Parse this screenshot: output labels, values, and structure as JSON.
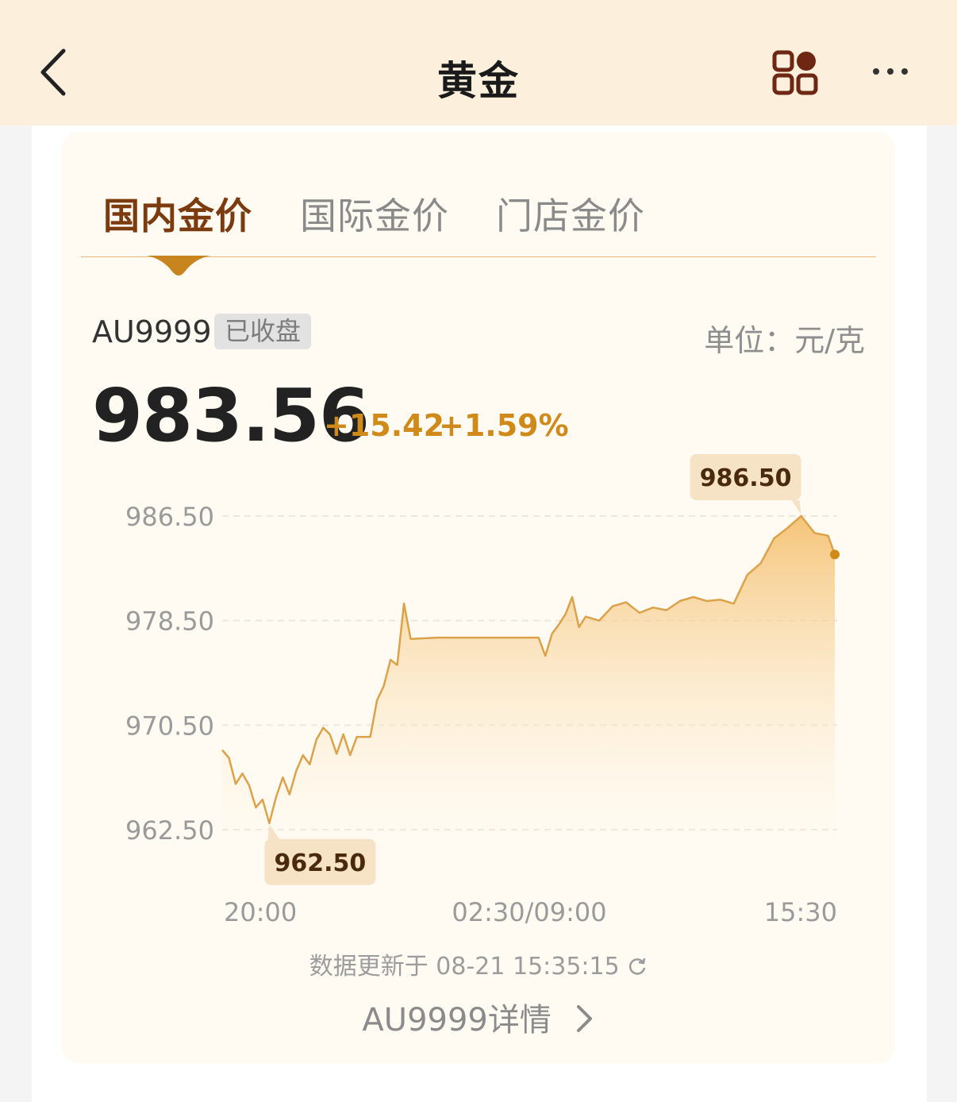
{
  "header": {
    "title": "黄金",
    "back_icon": "chevron-left-icon",
    "apps_icon": "apps-grid-icon",
    "more_icon": "more-dots-icon"
  },
  "tabs": [
    {
      "label": "国内金价",
      "active": true
    },
    {
      "label": "国际金价",
      "active": false
    },
    {
      "label": "门店金价",
      "active": false
    }
  ],
  "quote": {
    "symbol": "AU9999",
    "status": "已收盘",
    "unit": "单位：元/克",
    "price": "983.56",
    "change": "+15.42",
    "change_pct": "+1.59%"
  },
  "chart_data": {
    "type": "area",
    "y_ticks": [
      "986.50",
      "978.50",
      "970.50",
      "962.50"
    ],
    "x_ticks": [
      "20:00",
      "02:30/09:00",
      "15:30"
    ],
    "ylim": [
      962.5,
      986.5
    ],
    "max_label": "986.50",
    "min_label": "962.50",
    "series": [
      {
        "points": [
          [
            0,
            968.6
          ],
          [
            0.5,
            968.0
          ],
          [
            1,
            966.0
          ],
          [
            1.5,
            966.8
          ],
          [
            2,
            965.9
          ],
          [
            2.5,
            964.2
          ],
          [
            3,
            964.8
          ],
          [
            3.5,
            963.0
          ],
          [
            4,
            965.0
          ],
          [
            4.5,
            966.5
          ],
          [
            5,
            965.2
          ],
          [
            5.5,
            967.0
          ],
          [
            6,
            968.2
          ],
          [
            6.5,
            967.5
          ],
          [
            7,
            969.4
          ],
          [
            7.5,
            970.3
          ],
          [
            8,
            969.8
          ],
          [
            8.5,
            968.3
          ],
          [
            9,
            969.8
          ],
          [
            9.5,
            968.2
          ],
          [
            10,
            969.6
          ],
          [
            10.5,
            969.6
          ],
          [
            11,
            969.6
          ],
          [
            11.5,
            972.4
          ],
          [
            12,
            973.5
          ],
          [
            12.5,
            975.5
          ],
          [
            13,
            975.1
          ],
          [
            13.5,
            979.8
          ],
          [
            14,
            977.1
          ],
          [
            16,
            977.2
          ],
          [
            22,
            977.2
          ],
          [
            23.5,
            977.2
          ],
          [
            24,
            975.8
          ],
          [
            24.5,
            977.5
          ],
          [
            25,
            978.2
          ],
          [
            25.5,
            979.0
          ],
          [
            26,
            980.3
          ],
          [
            26.5,
            978.0
          ],
          [
            27,
            978.8
          ],
          [
            28,
            978.5
          ],
          [
            29,
            979.6
          ],
          [
            30,
            979.9
          ],
          [
            31,
            979.1
          ],
          [
            32,
            979.5
          ],
          [
            33,
            979.3
          ],
          [
            34,
            980.0
          ],
          [
            35,
            980.3
          ],
          [
            36,
            980.0
          ],
          [
            37,
            980.1
          ],
          [
            38,
            979.8
          ],
          [
            39,
            982.0
          ],
          [
            40,
            982.9
          ],
          [
            41,
            984.8
          ],
          [
            42,
            985.6
          ],
          [
            43,
            986.5
          ],
          [
            44,
            985.2
          ],
          [
            45,
            985.0
          ],
          [
            45.5,
            983.56
          ]
        ],
        "last": 983.56
      }
    ],
    "color": "#dba24a"
  },
  "footer": {
    "update_text": "数据更新于 08-21 15:35:15",
    "refresh_icon": "refresh-icon",
    "detail_link": "AU9999详情",
    "detail_icon": "chevron-right-icon"
  }
}
